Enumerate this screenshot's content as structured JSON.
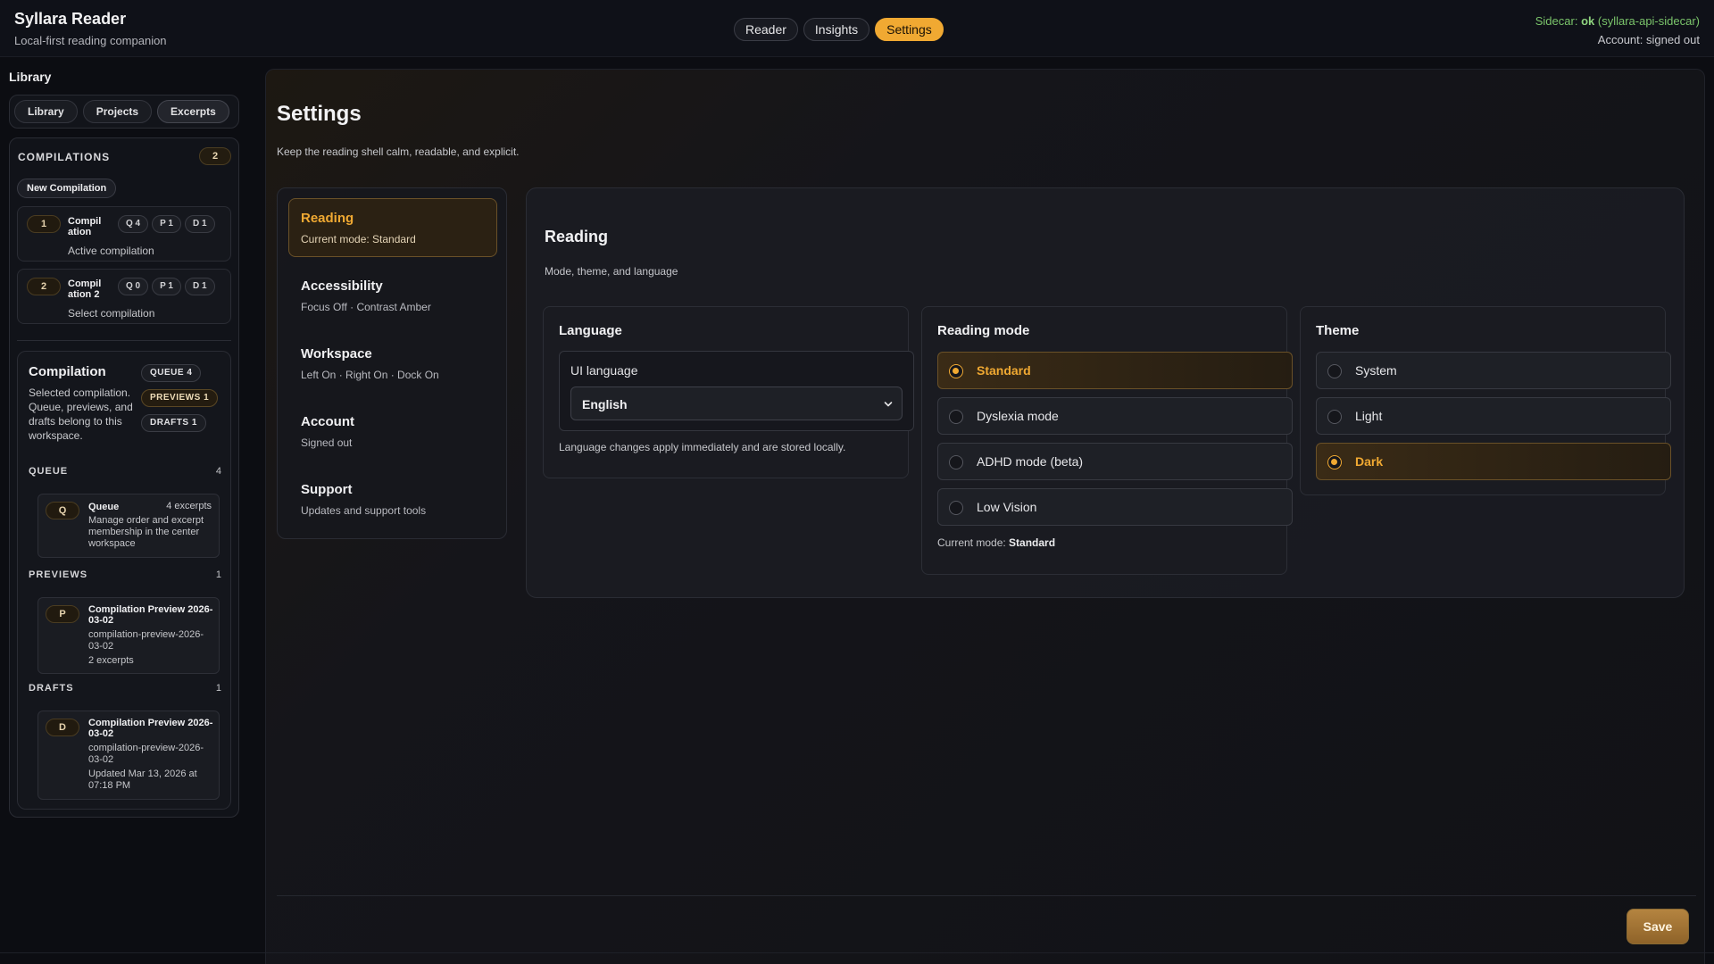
{
  "app": {
    "title": "Syllara Reader",
    "subtitle": "Local-first reading companion"
  },
  "topnav": {
    "tabs": [
      {
        "label": "Reader",
        "active": false
      },
      {
        "label": "Insights",
        "active": false
      },
      {
        "label": "Settings",
        "active": true
      }
    ]
  },
  "status": {
    "sidecar_prefix": "Sidecar:",
    "sidecar_state": "ok",
    "sidecar_name": "(syllara-api-sidecar)",
    "account": "Account: signed out",
    "ok_color": "#7bc56b"
  },
  "sidebar": {
    "heading": "Library",
    "tabs": [
      "Library",
      "Projects",
      "Excerpts"
    ],
    "compilations": {
      "title": "COMPILATIONS",
      "count": "2",
      "new_button": "New Compilation",
      "items": [
        {
          "num": "1",
          "name": "Compil ation",
          "q": "Q 4",
          "p": "P 1",
          "d": "D 1",
          "status": "Active compilation"
        },
        {
          "num": "2",
          "name": "Compil ation 2",
          "q": "Q 0",
          "p": "P 1",
          "d": "D 1",
          "status": "Select compilation"
        }
      ]
    },
    "detail": {
      "title": "Compilation",
      "description": "Selected compilation. Queue, previews, and drafts belong to this workspace.",
      "tags": [
        "QUEUE 4",
        "PREVIEWS 1",
        "DRAFTS 1"
      ],
      "queue": {
        "label": "QUEUE",
        "count": "4",
        "entry": {
          "chip": "Q",
          "title": "Queue",
          "meta": "4 excerpts",
          "text": "Manage order and excerpt membership in the center workspace"
        }
      },
      "previews": {
        "label": "PREVIEWS",
        "count": "1",
        "entry": {
          "chip": "P",
          "title": "Compilation Preview 2026-03-02",
          "slug": "compilation-preview-2026-03-02",
          "extra": "2 excerpts"
        }
      },
      "drafts": {
        "label": "DRAFTS",
        "count": "1",
        "entry": {
          "chip": "D",
          "title": "Compilation Preview 2026-03-02",
          "slug": "compilation-preview-2026-03-02",
          "extra": "Updated Mar 13, 2026 at 07:18 PM"
        }
      }
    }
  },
  "settings": {
    "title": "Settings",
    "subtitle": "Keep the reading shell calm, readable, and explicit.",
    "nav": [
      {
        "label": "Reading",
        "desc": "Current mode: Standard",
        "active": true
      },
      {
        "label": "Accessibility",
        "desc": "Focus Off · Contrast Amber",
        "active": false
      },
      {
        "label": "Workspace",
        "desc": "Left On · Right On · Dock On",
        "active": false
      },
      {
        "label": "Account",
        "desc": "Signed out",
        "active": false
      },
      {
        "label": "Support",
        "desc": "Updates and support tools",
        "active": false
      }
    ],
    "panel": {
      "title": "Reading",
      "subtitle": "Mode, theme, and language",
      "language": {
        "title": "Language",
        "field_label": "UI language",
        "selected": "English",
        "note": "Language changes apply immediately and are stored locally."
      },
      "reading_mode": {
        "title": "Reading mode",
        "options": [
          "Standard",
          "Dyslexia mode",
          "ADHD mode (beta)",
          "Low Vision"
        ],
        "selected": "Standard",
        "note_prefix": "Current mode:",
        "note_value": "Standard"
      },
      "theme": {
        "title": "Theme",
        "options": [
          "System",
          "Light",
          "Dark"
        ],
        "selected": "Dark"
      }
    },
    "save_label": "Save",
    "accent_color": "#f0a932"
  }
}
